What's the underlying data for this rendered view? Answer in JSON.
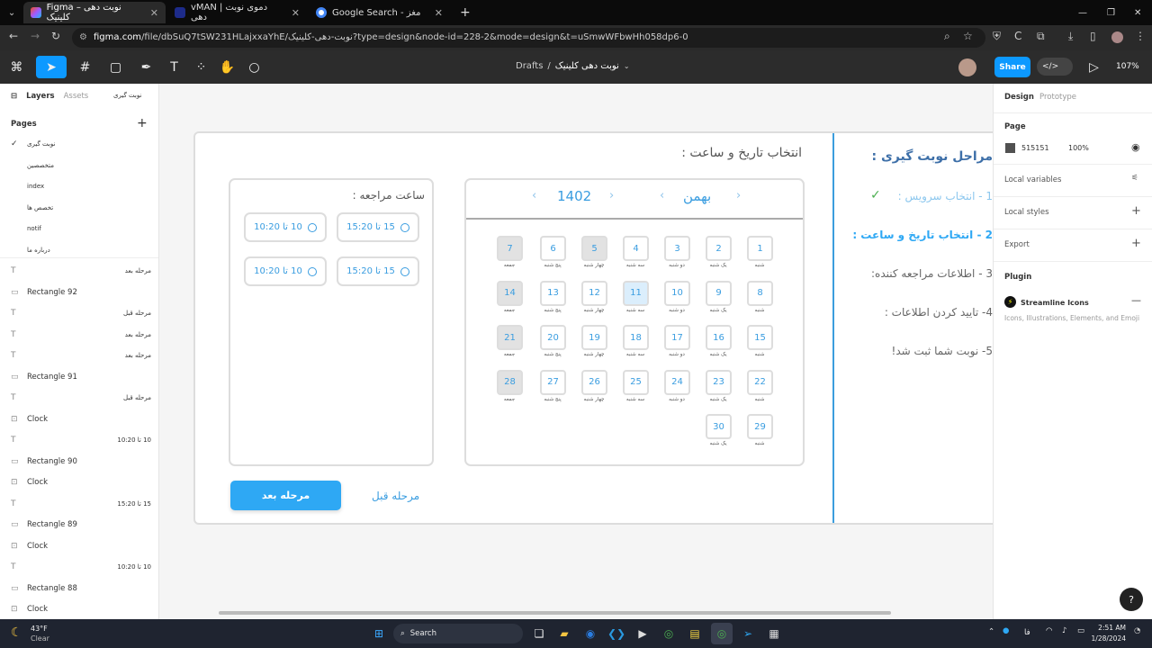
{
  "browser": {
    "tabs": [
      {
        "title": "Figma – نوبت دهی کلینیک",
        "active": true
      },
      {
        "title": "vMAN | دموی نوبت دهی",
        "active": false
      },
      {
        "title": "Google Search - مغز",
        "active": false
      }
    ],
    "url_host": "figma.com",
    "url_path": "/file/dbSuQ7tSW231HLajxxaYhE/نوبت-دهی-کلینیک?type=design&node-id=228-2&mode=design&t=uSmwWFbwHh058dp6-0"
  },
  "figma_toolbar": {
    "breadcrumb_root": "Drafts",
    "separator": "/",
    "file_name": "نوبت دهی کلینیک",
    "share_label": "Share",
    "zoom": "107%"
  },
  "left_panel": {
    "tab_layers": "Layers",
    "tab_assets": "Assets",
    "current_page_label": "نوبت گیری",
    "pages_header": "Pages",
    "pages": [
      "نوبت گیری",
      "متخصصین",
      "index",
      "تخصص ها",
      "notif",
      "درباره ما"
    ],
    "layers": [
      {
        "type": "T",
        "name": "مرحله بعد"
      },
      {
        "type": "rect",
        "name": "Rectangle 92"
      },
      {
        "type": "T",
        "name": "مرحله قبل"
      },
      {
        "type": "T",
        "name": "مرحله بعد"
      },
      {
        "type": "T",
        "name": "مرحله بعد"
      },
      {
        "type": "rect",
        "name": "Rectangle 91"
      },
      {
        "type": "T",
        "name": "مرحله قبل"
      },
      {
        "type": "frame",
        "name": "Clock"
      },
      {
        "type": "T",
        "name": "10 تا 10:20"
      },
      {
        "type": "rect",
        "name": "Rectangle 90"
      },
      {
        "type": "frame",
        "name": "Clock"
      },
      {
        "type": "T",
        "name": "15 تا 15:20"
      },
      {
        "type": "rect",
        "name": "Rectangle 89"
      },
      {
        "type": "frame",
        "name": "Clock"
      },
      {
        "type": "T",
        "name": "10 تا 10:20"
      },
      {
        "type": "rect",
        "name": "Rectangle 88"
      },
      {
        "type": "frame",
        "name": "Clock"
      }
    ]
  },
  "design": {
    "steps_title": "مراحل نوبت گیری :",
    "steps": [
      {
        "text": "1 - انتخاب سرویس :",
        "state": "done"
      },
      {
        "text": "2 - انتخاب تاریخ و ساعت :",
        "state": "current"
      },
      {
        "text": "3 - اطلاعات مراجعه کننده:",
        "state": "todo"
      },
      {
        "text": "4- تایید کردن اطلاعات :",
        "state": "todo"
      },
      {
        "text": "5- نوبت شما ثبت شد!",
        "state": "todo"
      }
    ],
    "section_title": "انتخاب تاریخ و ساعت :",
    "calendar": {
      "month": "بهمن",
      "year": "1402",
      "days": [
        {
          "n": "1",
          "label": "شنبه"
        },
        {
          "n": "2",
          "label": "یک شنبه"
        },
        {
          "n": "3",
          "label": "دو شنبه"
        },
        {
          "n": "4",
          "label": "سه شنبه"
        },
        {
          "n": "5",
          "label": "چهار شنبه",
          "style": "grey"
        },
        {
          "n": "6",
          "label": "پنج شنبه"
        },
        {
          "n": "7",
          "label": "جمعه",
          "style": "grey"
        },
        {
          "n": "8",
          "label": "شنبه"
        },
        {
          "n": "9",
          "label": "یک شنبه"
        },
        {
          "n": "10",
          "label": "دو شنبه"
        },
        {
          "n": "11",
          "label": "سه شنبه",
          "style": "blue"
        },
        {
          "n": "12",
          "label": "چهار شنبه"
        },
        {
          "n": "13",
          "label": "پنج شنبه"
        },
        {
          "n": "14",
          "label": "جمعه",
          "style": "grey"
        },
        {
          "n": "15",
          "label": "شنبه"
        },
        {
          "n": "16",
          "label": "یک شنبه"
        },
        {
          "n": "17",
          "label": "دو شنبه"
        },
        {
          "n": "18",
          "label": "سه شنبه"
        },
        {
          "n": "19",
          "label": "چهار شنبه"
        },
        {
          "n": "20",
          "label": "پنج شنبه"
        },
        {
          "n": "21",
          "label": "جمعه",
          "style": "grey"
        },
        {
          "n": "22",
          "label": "شنبه"
        },
        {
          "n": "23",
          "label": "یک شنبه"
        },
        {
          "n": "24",
          "label": "دو شنبه"
        },
        {
          "n": "25",
          "label": "سه شنبه"
        },
        {
          "n": "26",
          "label": "چهار شنبه"
        },
        {
          "n": "27",
          "label": "پنج شنبه"
        },
        {
          "n": "28",
          "label": "جمعه",
          "style": "grey"
        },
        {
          "n": "29",
          "label": "شنبه"
        },
        {
          "n": "30",
          "label": "یک شنبه"
        }
      ]
    },
    "time_title": "ساعت مراجعه :",
    "slots": [
      "15 تا 15:20",
      "10 تا 10:20",
      "15 تا 15:20",
      "10 تا 10:20"
    ],
    "next_button": "مرحله بعد",
    "prev_button": "مرحله قبل"
  },
  "right_panel": {
    "tab_design": "Design",
    "tab_prototype": "Prototype",
    "page_header": "Page",
    "page_color": "515151",
    "page_opacity": "100%",
    "local_variables": "Local variables",
    "local_styles": "Local styles",
    "export": "Export",
    "plugin_header": "Plugin",
    "plugin_name": "Streamline Icons",
    "plugin_desc": "Icons, Illustrations, Elements, and Emoji"
  },
  "taskbar": {
    "weather_temp": "43°F",
    "weather_desc": "Clear",
    "search_label": "Search",
    "lang": "فا",
    "time": "2:51 AM",
    "date": "1/28/2024"
  },
  "colors": {
    "accent_blue": "#0d99ff",
    "brand_blue": "#2ea8f4",
    "check_green": "#4caf50"
  }
}
